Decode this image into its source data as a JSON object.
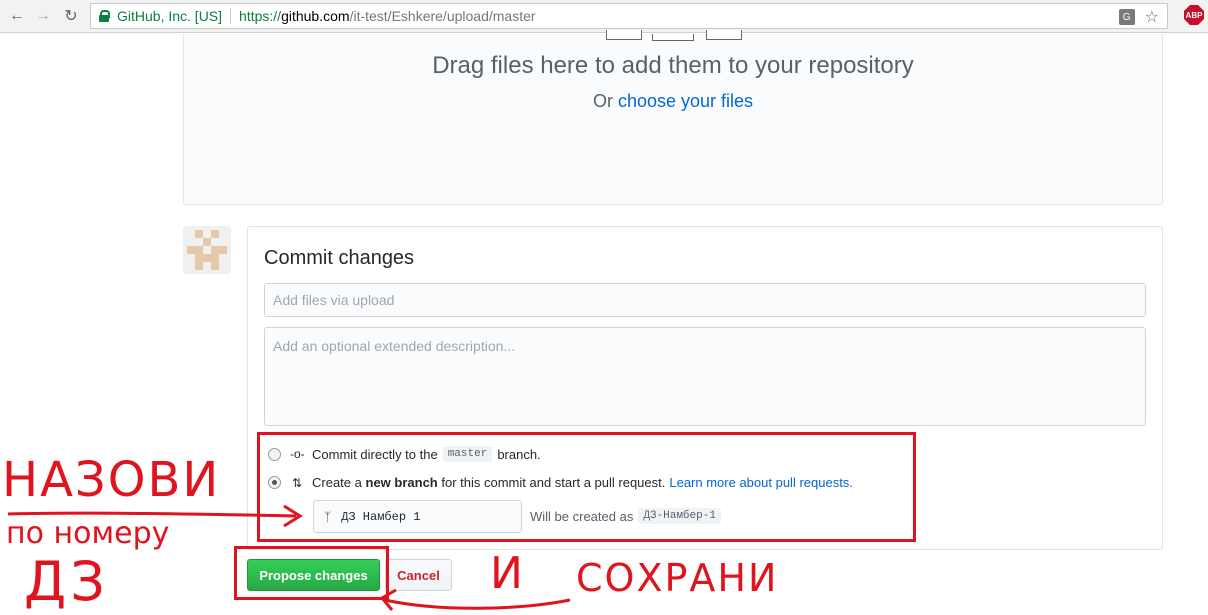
{
  "browser": {
    "org_badge": "GitHub, Inc. [US]",
    "url_scheme": "https://",
    "url_host": "github.com",
    "url_path": "/it-test/Eshkere/upload/master",
    "translate_icon": "translate-icon",
    "star_icon": "star-icon",
    "abp_label": "ABP"
  },
  "dropzone": {
    "title": "Drag files here to add them to your repository",
    "sub_prefix": "Or",
    "choose_link": "choose your files"
  },
  "commit": {
    "title": "Commit changes",
    "summary_placeholder": "Add files via upload",
    "description_placeholder": "Add an optional extended description...",
    "option_direct": {
      "prefix": "Commit directly to the",
      "branch": "master",
      "suffix": "branch.",
      "selected": false
    },
    "option_new_branch": {
      "prefix": "Create a",
      "bold": "new branch",
      "middle": "for this commit and start a pull request.",
      "link": "Learn more about pull requests.",
      "selected": true
    },
    "branch_name_value": "ДЗ Намбер 1",
    "will_be_created_label": "Will be created as",
    "will_be_created_value": "ДЗ-Намбер-1"
  },
  "buttons": {
    "propose": "Propose changes",
    "cancel": "Cancel"
  },
  "annotations": {
    "name_it": "НАЗОВИ",
    "by_number": "по номеру",
    "hw": "ДЗ",
    "and": "И",
    "save": "СОХРАНИ",
    "color": "#e0141e"
  }
}
